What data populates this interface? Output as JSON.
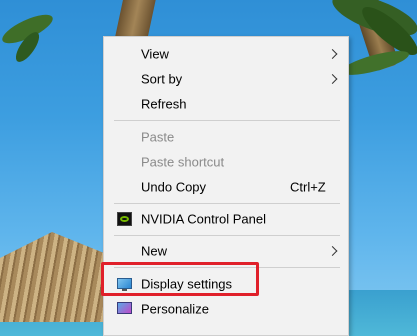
{
  "context_menu": {
    "items": [
      {
        "label": "View",
        "submenu": true
      },
      {
        "label": "Sort by",
        "submenu": true
      },
      {
        "label": "Refresh"
      },
      {
        "label": "Paste",
        "disabled": true
      },
      {
        "label": "Paste shortcut",
        "disabled": true
      },
      {
        "label": "Undo Copy",
        "shortcut": "Ctrl+Z"
      },
      {
        "label": "NVIDIA Control Panel",
        "icon": "nvidia-icon"
      },
      {
        "label": "New",
        "submenu": true
      },
      {
        "label": "Display settings",
        "icon": "display-icon",
        "highlighted": true
      },
      {
        "label": "Personalize",
        "icon": "personalize-icon"
      }
    ]
  },
  "colors": {
    "highlight_border": "#e0202a",
    "menu_background": "#f2f2f2",
    "disabled_text": "#8a8a8a"
  }
}
